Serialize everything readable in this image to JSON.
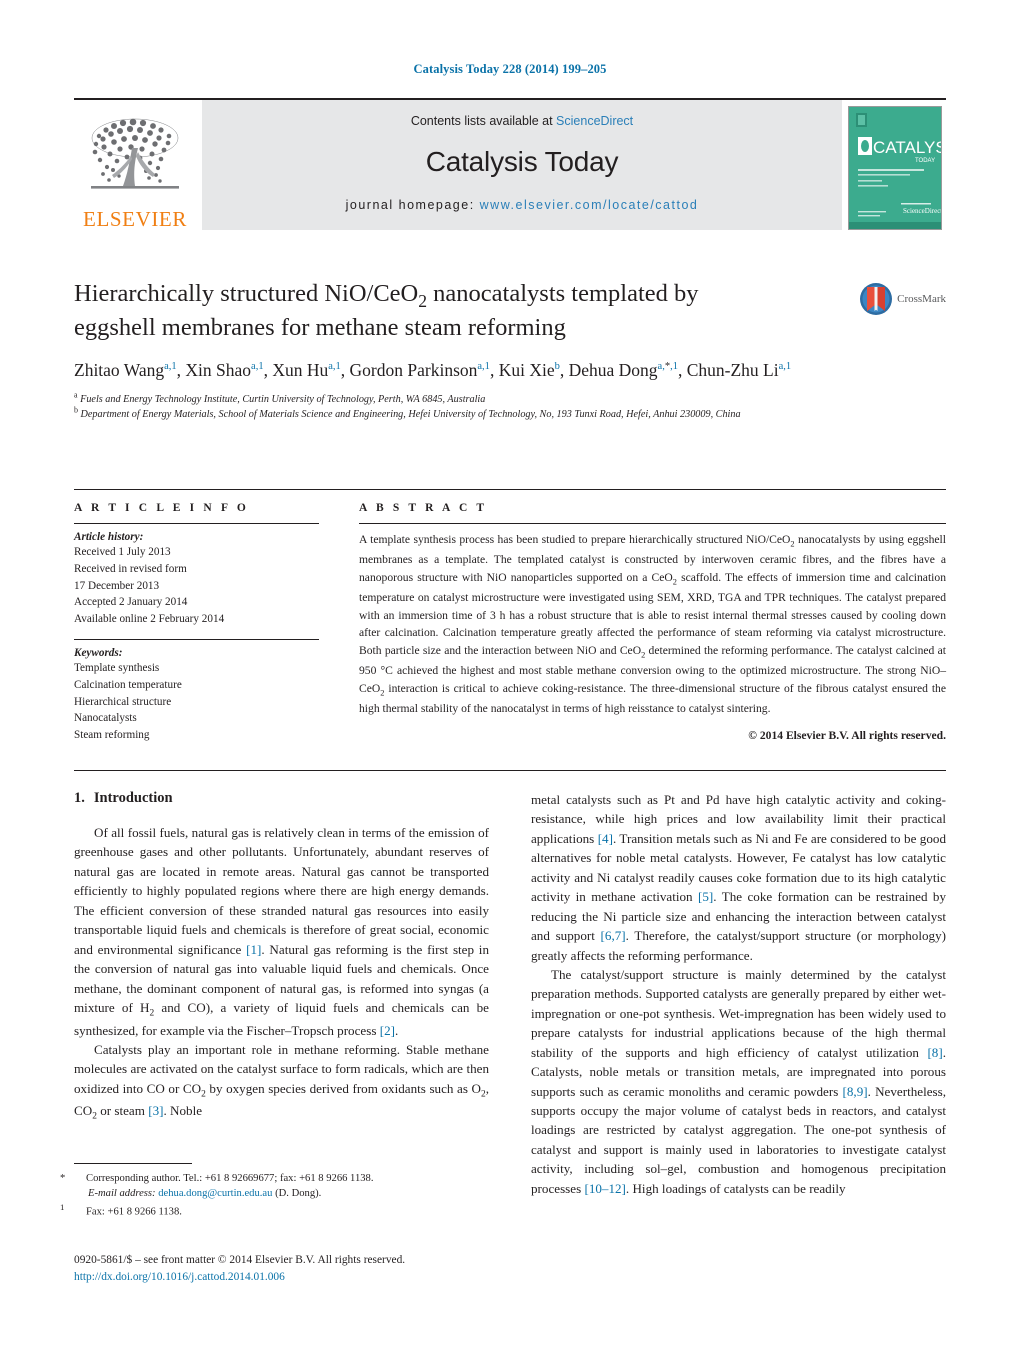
{
  "running_head": "Catalysis Today 228 (2014) 199–205",
  "masthead": {
    "publisher_name": "ELSEVIER",
    "contents_prefix": "Contents lists available at ",
    "contents_link": "ScienceDirect",
    "journal_title": "Catalysis Today",
    "homepage_label": "journal homepage:",
    "homepage_url": "www.elsevier.com/locate/cattod",
    "cover_title": "CATALYSIS",
    "cover_sub": "TODAY"
  },
  "article": {
    "title": "Hierarchically structured NiO/CeO2 nanocatalysts templated by eggshell membranes for methane steam reforming",
    "crossmark_label": "CrossMark",
    "authors": [
      {
        "name": "Zhitao Wang",
        "sups": "a,1",
        "sep": ", "
      },
      {
        "name": "Xin Shao",
        "sups": "a,1",
        "sep": ", "
      },
      {
        "name": "Xun Hu",
        "sups": "a,1",
        "sep": ", "
      },
      {
        "name": "Gordon Parkinson",
        "sups": "a,1",
        "sep": ", "
      },
      {
        "name": "Kui Xie",
        "sups": "b",
        "sep": ", "
      },
      {
        "name": "Dehua Dong",
        "sups": "a,*,1",
        "sep": ", "
      },
      {
        "name": "Chun-Zhu Li",
        "sups": "a,1",
        "sep": ""
      }
    ],
    "affiliations": [
      {
        "mark": "a",
        "text": "Fuels and Energy Technology Institute, Curtin University of Technology, Perth, WA 6845, Australia"
      },
      {
        "mark": "b",
        "text": "Department of Energy Materials, School of Materials Science and Engineering, Hefei University of Technology, No, 193 Tunxi Road, Hefei, Anhui 230009, China"
      }
    ]
  },
  "info": {
    "heading": "A R T I C L E   I N F O",
    "history_label": "Article history:",
    "history": [
      "Received 1 July 2013",
      "Received in revised form",
      "17 December 2013",
      "Accepted 2 January 2014",
      "Available online 2 February 2014"
    ],
    "keywords_label": "Keywords:",
    "keywords": [
      "Template synthesis",
      "Calcination temperature",
      "Hierarchical structure",
      "Nanocatalysts",
      "Steam reforming"
    ]
  },
  "abstract": {
    "heading": "A B S T R A C T",
    "paragraphs": [
      "A template synthesis process has been studied to prepare hierarchically structured NiO/CeO2 nanocatalysts by using eggshell membranes as a template. The templated catalyst is constructed by interwoven ceramic fibres, and the fibres have a nanoporous structure with NiO nanoparticles supported on a CeO2 scaffold. The effects of immersion time and calcination temperature on catalyst microstructure were investigated using SEM, XRD, TGA and TPR techniques. The catalyst prepared with an immersion time of 3 h has a robust structure that is able to resist internal thermal stresses caused by cooling down after calcination. Calcination temperature greatly affected the performance of steam reforming via catalyst microstructure. Both particle size and the interaction between NiO and CeO2 determined the reforming performance. The catalyst calcined at 950 °C achieved the highest and most stable methane conversion owing to the optimized microstructure. The strong NiO–CeO2 interaction is critical to achieve coking-resistance. The three-dimensional structure of the fibrous catalyst ensured the high thermal stability of the nanocatalyst in terms of high reisstance to catalyst sintering."
    ],
    "copyright": "© 2014 Elsevier B.V. All rights reserved."
  },
  "body": {
    "section_number": "1.",
    "section_title": "Introduction",
    "left_paragraphs": [
      "Of all fossil fuels, natural gas is relatively clean in terms of the emission of greenhouse gases and other pollutants. Unfortunately, abundant reserves of natural gas are located in remote areas. Natural gas cannot be transported efficiently to highly populated regions where there are high energy demands. The efficient conversion of these stranded natural gas resources into easily transportable liquid fuels and chemicals is therefore of great social, economic and environmental significance [1]. Natural gas reforming is the first step in the conversion of natural gas into valuable liquid fuels and chemicals. Once methane, the dominant component of natural gas, is reformed into syngas (a mixture of H2 and CO), a variety of liquid fuels and chemicals can be synthesized, for example via the Fischer–Tropsch process [2].",
      "Catalysts play an important role in methane reforming. Stable methane molecules are activated on the catalyst surface to form radicals, which are then oxidized into CO or CO2 by oxygen species derived from oxidants such as O2, CO2 or steam [3]. Noble"
    ],
    "right_paragraphs": [
      "metal catalysts such as Pt and Pd have high catalytic activity and coking-resistance, while high prices and low availability limit their practical applications [4]. Transition metals such as Ni and Fe are considered to be good alternatives for noble metal catalysts. However, Fe catalyst has low catalytic activity and Ni catalyst readily causes coke formation due to its high catalytic activity in methane activation [5]. The coke formation can be restrained by reducing the Ni particle size and enhancing the interaction between catalyst and support [6,7]. Therefore, the catalyst/support structure (or morphology) greatly affects the reforming performance.",
      "The catalyst/support structure is mainly determined by the catalyst preparation methods. Supported catalysts are generally prepared by either wet-impregnation or one-pot synthesis. Wet-impregnation has been widely used to prepare catalysts for industrial applications because of the high thermal stability of the supports and high efficiency of catalyst utilization [8]. Catalysts, noble metals or transition metals, are impregnated into porous supports such as ceramic monoliths and ceramic powders [8,9]. Nevertheless, supports occupy the major volume of catalyst beds in reactors, and catalyst loadings are restricted by catalyst aggregation. The one-pot synthesis of catalyst and support is mainly used in laboratories to investigate catalyst activity, including sol–gel, combustion and homogenous precipitation processes [10–12]. High loadings of catalysts can be readily"
    ]
  },
  "footnotes": {
    "corresponding": "Corresponding author. Tel.: +61 8 92669677; fax: +61 8 9266 1138.",
    "email_label": "E-mail address:",
    "email": "dehua.dong@curtin.edu.au",
    "email_suffix": "(D. Dong).",
    "fax_note": "Fax: +61 8 9266 1138."
  },
  "colophon": {
    "line1": "0920-5861/$ – see front matter © 2014 Elsevier B.V. All rights reserved.",
    "doi": "http://dx.doi.org/10.1016/j.cattod.2014.01.006"
  },
  "colors": {
    "link": "#0a72a8",
    "elsevier_orange": "#f07f13",
    "masthead_grey": "#e6e7e8",
    "cover_green": "#3cab8e"
  }
}
